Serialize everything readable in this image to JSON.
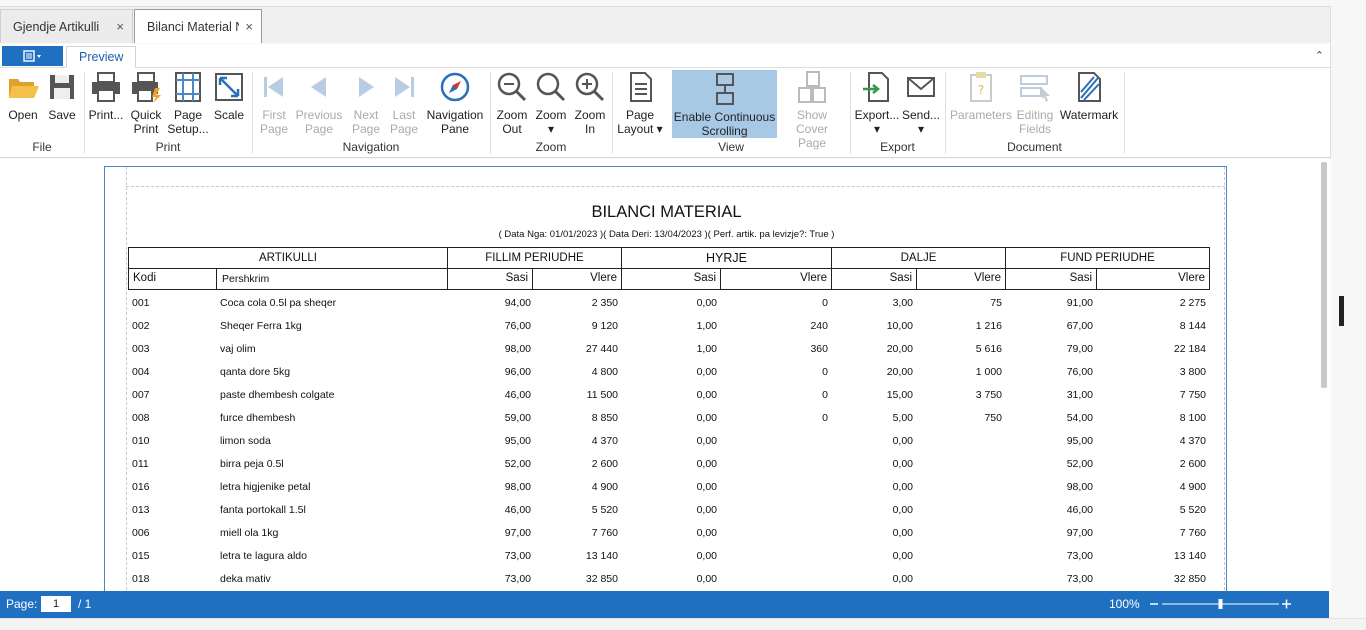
{
  "tabs": [
    {
      "label": "Gjendje Artikulli",
      "close": "×"
    },
    {
      "label": "Bilanci Material N",
      "close": "×"
    }
  ],
  "ribbon_tab": "Preview",
  "groups": {
    "file": "File",
    "print": "Print",
    "navigation": "Navigation",
    "zoom": "Zoom",
    "view": "View",
    "export": "Export",
    "document": "Document"
  },
  "buttons": {
    "open": "Open",
    "save": "Save",
    "print": "Print...",
    "quick_print_1": "Quick",
    "quick_print_2": "Print",
    "page_setup_1": "Page",
    "page_setup_2": "Setup...",
    "scale": "Scale",
    "first_page_1": "First",
    "first_page_2": "Page",
    "prev_page_1": "Previous",
    "prev_page_2": "Page",
    "next_page_1": "Next",
    "next_page_2": "Page",
    "last_page_1": "Last",
    "last_page_2": "Page",
    "nav_pane_1": "Navigation",
    "nav_pane_2": "Pane",
    "zoom_out_1": "Zoom",
    "zoom_out_2": "Out",
    "zoom_1": "Zoom",
    "zoom_2": "▾",
    "zoom_in_1": "Zoom",
    "zoom_in_2": "In",
    "page_layout_1": "Page",
    "page_layout_2": "Layout ▾",
    "continuous_1": "Enable Continuous",
    "continuous_2": "Scrolling",
    "cover_1": "Show Cover",
    "cover_2": "Page",
    "export_1": "Export...",
    "export_2": "▾",
    "send_1": "Send...",
    "send_2": "▾",
    "parameters": "Parameters",
    "editing_1": "Editing",
    "editing_2": "Fields",
    "watermark": "Watermark"
  },
  "report": {
    "title": "BILANCI MATERIAL",
    "subtitle": "( Data Nga: 01/01/2023 )( Data Deri: 13/04/2023 )( Perf. artik. pa levizje?: True )",
    "groups": {
      "artikulli": "ARTIKULLI",
      "fillim": "FILLIM PERIUDHE",
      "hyrje": "HYRJE",
      "dalje": "DALJE",
      "fund": "FUND PERIUDHE"
    },
    "cols": {
      "kodi": "Kodi",
      "pershkrim": "Pershkrim",
      "sasi": "Sasi",
      "vlere": "Vlere"
    },
    "rows": [
      [
        "001",
        "Coca cola 0.5l pa sheqer",
        "94,00",
        "2 350",
        "0,00",
        "0",
        "3,00",
        "75",
        "91,00",
        "2 275"
      ],
      [
        "002",
        "Sheqer Ferra 1kg",
        "76,00",
        "9 120",
        "1,00",
        "240",
        "10,00",
        "1 216",
        "67,00",
        "8 144"
      ],
      [
        "003",
        "vaj olim",
        "98,00",
        "27 440",
        "1,00",
        "360",
        "20,00",
        "5 616",
        "79,00",
        "22 184"
      ],
      [
        "004",
        "qanta dore 5kg",
        "96,00",
        "4 800",
        "0,00",
        "0",
        "20,00",
        "1 000",
        "76,00",
        "3 800"
      ],
      [
        "007",
        "paste dhembesh colgate",
        "46,00",
        "11 500",
        "0,00",
        "0",
        "15,00",
        "3 750",
        "31,00",
        "7 750"
      ],
      [
        "008",
        "furce dhembesh",
        "59,00",
        "8 850",
        "0,00",
        "0",
        "5,00",
        "750",
        "54,00",
        "8 100"
      ],
      [
        "010",
        "limon soda",
        "95,00",
        "4 370",
        "0,00",
        "",
        "0,00",
        "",
        "95,00",
        "4 370"
      ],
      [
        "011",
        "birra peja 0.5l",
        "52,00",
        "2 600",
        "0,00",
        "",
        "0,00",
        "",
        "52,00",
        "2 600"
      ],
      [
        "016",
        "letra higjenike petal",
        "98,00",
        "4 900",
        "0,00",
        "",
        "0,00",
        "",
        "98,00",
        "4 900"
      ],
      [
        "013",
        "fanta portokall 1.5l",
        "46,00",
        "5 520",
        "0,00",
        "",
        "0,00",
        "",
        "46,00",
        "5 520"
      ],
      [
        "006",
        "miell ola 1kg",
        "97,00",
        "7 760",
        "0,00",
        "",
        "0,00",
        "",
        "97,00",
        "7 760"
      ],
      [
        "015",
        "letra te lagura aldo",
        "73,00",
        "13 140",
        "0,00",
        "",
        "0,00",
        "",
        "73,00",
        "13 140"
      ],
      [
        "018",
        "deka mativ",
        "73,00",
        "32 850",
        "0,00",
        "",
        "0,00",
        "",
        "73,00",
        "32 850"
      ]
    ]
  },
  "status": {
    "page_label": "Page:",
    "page_value": "1",
    "page_of": "/ 1",
    "zoom": "100%"
  },
  "zoom_slider_value": 0.5
}
